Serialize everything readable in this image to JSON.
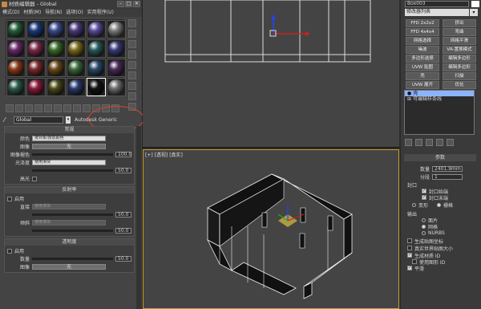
{
  "material_editor": {
    "title": "材质编辑器 - Global",
    "menu": [
      "模式(D)",
      "材质(M)",
      "导航(N)",
      "选项(O)",
      "实用程序(U)"
    ],
    "window_buttons": [
      "–",
      "□",
      "✕"
    ],
    "slot_colors": [
      "#245e3a",
      "#1a3a7a",
      "#3a4a8a",
      "#4a3a7a",
      "#5a4a9a",
      "#7a7a7a",
      "#6a2a6a",
      "#7a2a4a",
      "#3a6a2a",
      "#7a6a1a",
      "#2a5a5a",
      "#3a3a7a",
      "#8a3a1a",
      "#7a2a2a",
      "#6a4a1a",
      "#3a6a3a",
      "#2a4a6a",
      "#4a2a5a",
      "#2a5a4a",
      "#8a1a3a",
      "#4a4a1a",
      "#2a3a6a",
      "#111111",
      "#6a6a6a"
    ],
    "material_name": "Global",
    "material_type": "Autodesk Generic",
    "rollout_common": {
      "header": "常规",
      "color_label": "颜色",
      "color_value": "按对象/按层颜色",
      "image_label": "图像",
      "image_value": "无",
      "fade_label": "图像褪色",
      "fade_value": "100.0",
      "gloss_label": "光泽度",
      "gloss_value": "使用滑块",
      "gloss_number": "50.0",
      "highlight_label": "高光"
    },
    "rollout_reflect": {
      "header": "反射率",
      "enable": "启用",
      "direct_label": "直接",
      "direct_value": "使用滑块",
      "direct_number": "50.0",
      "oblique_label": "倾斜",
      "oblique_value": "使用滑块",
      "oblique_number": "50.0"
    },
    "rollout_transp": {
      "header": "透明度",
      "enable": "启用",
      "amount_label": "数量",
      "amount_number": "50.0",
      "image_label": "图像",
      "image_value": "无"
    }
  },
  "viewport_persp": {
    "label": "[+] [透视] [真实]"
  },
  "command_panel": {
    "object_name": "Box003",
    "modifier_list": "修改器列表",
    "buttons": [
      "FFD 2x2x2",
      "挤出",
      "FFD 4x4x4",
      "弯曲",
      "网格选择",
      "网格平滑",
      "噪波",
      "VR-置换模式",
      "多边形选择",
      "编辑多边形",
      "UVW 贴图",
      "编辑多边形",
      "壳",
      "扫描",
      "UVW 展开",
      "优化"
    ],
    "stack": [
      "壳",
      "可编辑样条线"
    ],
    "params_header": "参数",
    "amount_label": "数量",
    "amount_value": "2401.9mm",
    "segments_label": "分段",
    "segments_value": "1",
    "cap_header": "封口",
    "cap_start": "封口始端",
    "cap_end": "封口末端",
    "morph": "变形",
    "grid": "栅格",
    "output_header": "输出",
    "output_patch": "面片",
    "output_mesh": "网格",
    "output_nurbs": "NURBS",
    "gen_map": "生成贴图坐标",
    "real_world": "真实世界贴图大小",
    "gen_matid": "生成材质 ID",
    "use_shape_id": "使用图形 ID",
    "smooth": "平滑"
  }
}
